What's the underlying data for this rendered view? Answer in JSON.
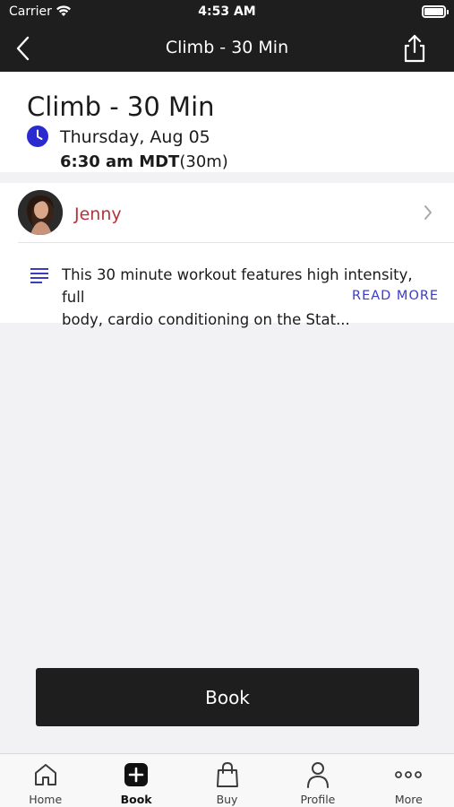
{
  "status_bar": {
    "carrier": "Carrier",
    "time": "4:53 AM"
  },
  "nav": {
    "title": "Climb - 30 Min",
    "back_icon": "chevron-left-icon",
    "share_icon": "share-icon"
  },
  "class_info": {
    "title": "Climb - 30 Min",
    "date": "Thursday, Aug 05",
    "start_time": "6:30 am MDT",
    "duration": "(30m)",
    "accent_color": "#2a2ad0"
  },
  "instructor": {
    "name": "Jenny",
    "name_color": "#b5333a"
  },
  "description": {
    "line1": "This 30 minute workout features high intensity, full",
    "line2": "body, cardio conditioning on the Stat...",
    "read_more": "READ MORE"
  },
  "book_button": {
    "label": "Book"
  },
  "tabs": [
    {
      "label": "Home",
      "icon": "home-icon",
      "active": false
    },
    {
      "label": "Book",
      "icon": "plus-square-icon",
      "active": true
    },
    {
      "label": "Buy",
      "icon": "shopping-bag-icon",
      "active": false
    },
    {
      "label": "Profile",
      "icon": "person-icon",
      "active": false
    },
    {
      "label": "More",
      "icon": "more-dots-icon",
      "active": false
    }
  ]
}
